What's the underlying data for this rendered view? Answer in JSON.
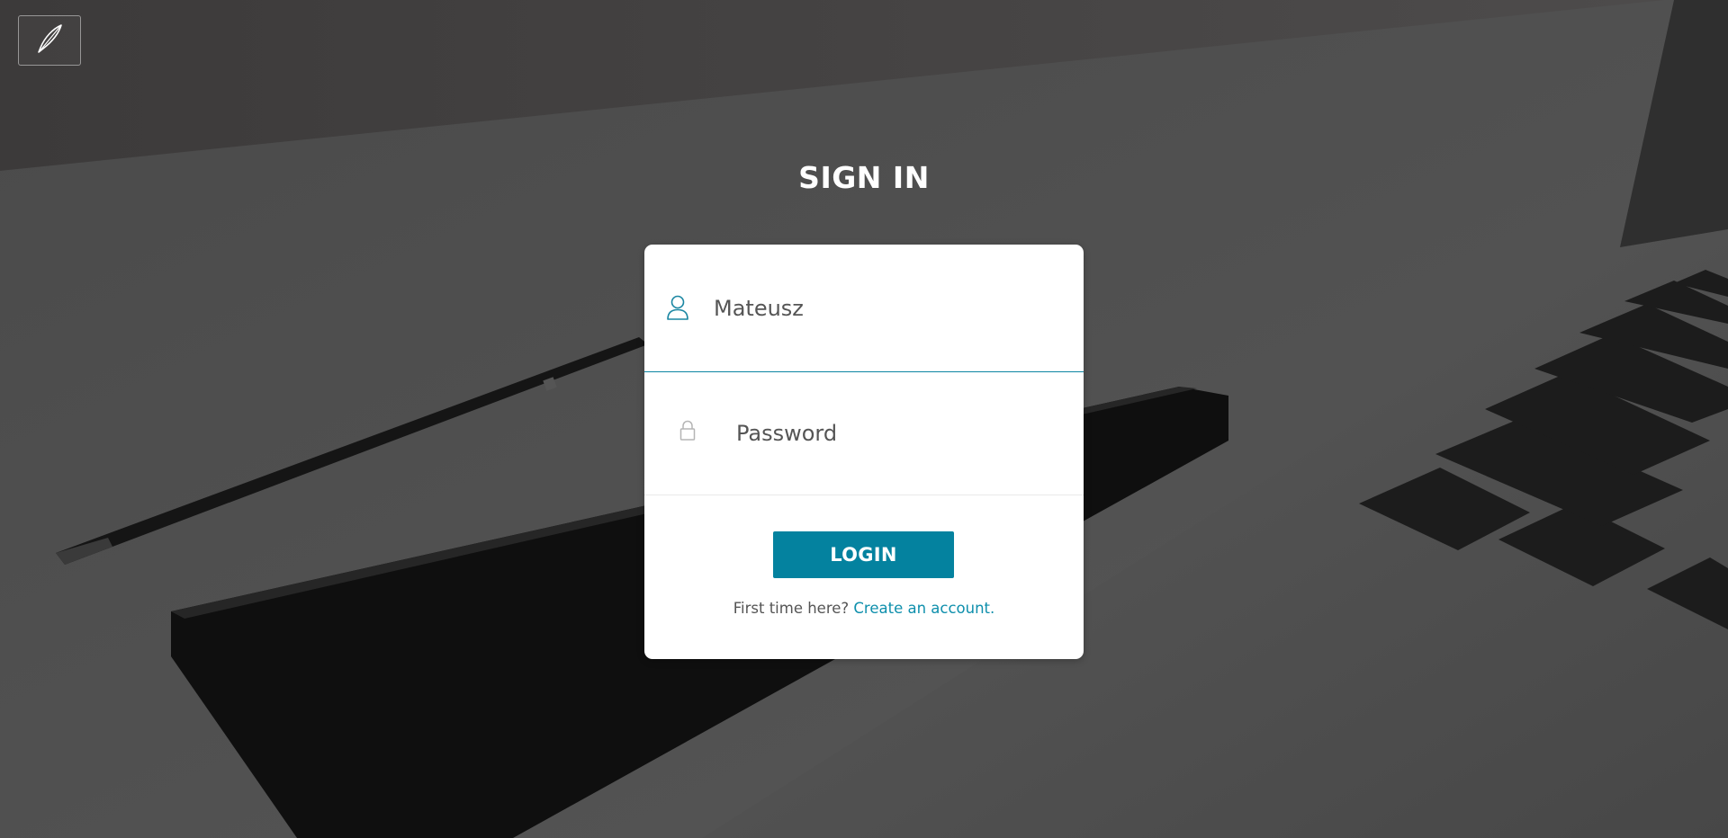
{
  "page": {
    "title": "SIGN IN"
  },
  "header": {
    "logo_icon": "feather-pen-icon"
  },
  "form": {
    "username": {
      "icon": "user-icon",
      "value": "Mateusz",
      "placeholder": ""
    },
    "password": {
      "icon": "lock-icon",
      "value": "",
      "placeholder": "Password"
    },
    "login_label": "LOGIN",
    "signup_prompt": "First time here?",
    "signup_link": "Create an account."
  },
  "colors": {
    "accent": "#04829f",
    "link": "#0e8fac",
    "card_bg": "#ffffff",
    "title": "#ffffff"
  }
}
